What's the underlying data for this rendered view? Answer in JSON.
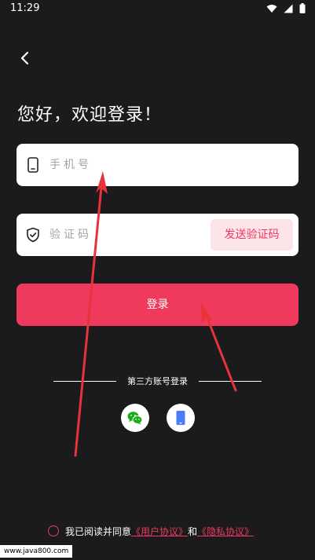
{
  "status_bar": {
    "time": "11:29"
  },
  "header": {
    "greeting": "您好，欢迎登录！"
  },
  "phone_field": {
    "placeholder": "手机号",
    "value": ""
  },
  "code_field": {
    "placeholder": "验证码",
    "value": "",
    "send_code_label": "发送验证码"
  },
  "login_button": {
    "label": "登录"
  },
  "third_party": {
    "divider_label": "第三方账号登录",
    "options": [
      {
        "icon": "wechat-icon",
        "color": "#1aad19"
      },
      {
        "icon": "phone-icon",
        "color": "#4a7cf6"
      }
    ]
  },
  "agreement": {
    "prefix": "我已阅读并同意",
    "user_agreement": "《用户协议》",
    "conjunction": "和",
    "privacy_agreement": "《隐私协议》"
  },
  "watermark": "www.java800.com",
  "colors": {
    "accent": "#ef3a5d",
    "background": "#1b1a1c",
    "annotation_arrow": "#e8323c"
  }
}
